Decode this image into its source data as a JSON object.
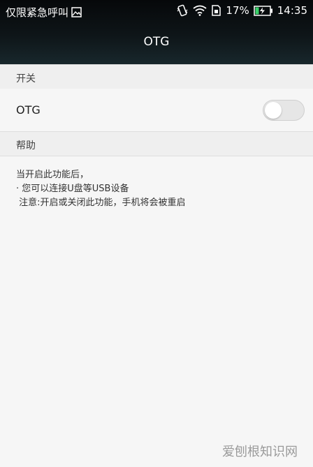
{
  "status_bar": {
    "carrier_text": "仅限紧急呼叫",
    "battery_percent": "17%",
    "time": "14:35",
    "icons": [
      "image-icon",
      "vibrate-icon",
      "wifi-icon",
      "sim-icon",
      "battery-charging-icon"
    ]
  },
  "header": {
    "title": "OTG"
  },
  "sections": {
    "switch_header": "开关",
    "help_header": "帮助"
  },
  "otg_row": {
    "label": "OTG",
    "toggle_on": false
  },
  "help": {
    "line1": "当开启此功能后，",
    "line2": "· 您可以连接U盘等USB设备",
    "line3": " 注意:开启或关闭此功能，手机将会被重启"
  },
  "watermark": "爱刨根知识网",
  "colors": {
    "header_bg": "#0e1518",
    "page_bg": "#f6f6f6",
    "section_bg": "#efefef"
  }
}
